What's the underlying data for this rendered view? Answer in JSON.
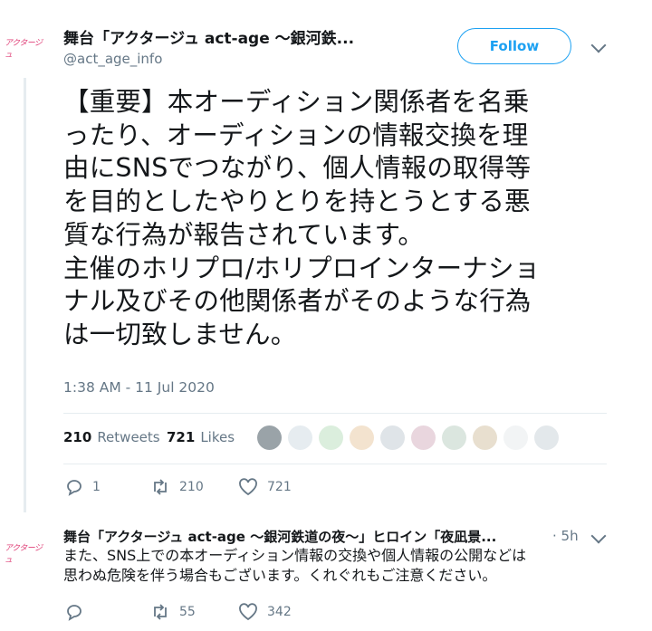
{
  "tweet": {
    "avatar_text": "アクタージュ",
    "display_name": "舞台「アクタージュ act-age ～銀河鉄...",
    "handle": "@act_age_info",
    "follow_label": "Follow",
    "text": "【重要】本オーディション関係者を名乗\nったり、オーディションの情報交換を理\n由にSNSでつながり、個人情報の取得等\nを目的としたやりとりを持とうとする悪\n質な行為が報告されています。\n主催のホリプロ/ホリプロインターナショ\nナル及びその他関係者がそのような行為\nは一切致しません。",
    "timestamp": "1:38 AM - 11 Jul 2020",
    "retweets_count": "210",
    "retweets_label": "Retweets",
    "likes_count": "721",
    "likes_label": "Likes",
    "actions": {
      "replies": "1",
      "retweets": "210",
      "likes": "721"
    }
  },
  "reply": {
    "avatar_text": "アクタージュ",
    "display_name": "舞台「アクタージュ act-age ～銀河鉄道の夜～」ヒロイン「夜凪景...",
    "time": "· 5h",
    "text": "また、SNS上での本オーディション情報の交換や個人情報の公開などは\n思わぬ危険を伴う場合もございます。くれぐれもご注意ください。",
    "actions": {
      "replies": "",
      "retweets": "55",
      "likes": "342"
    }
  },
  "colors": {
    "accent": "#1da1f2",
    "muted": "#657786",
    "divider": "#e6ecf0"
  }
}
